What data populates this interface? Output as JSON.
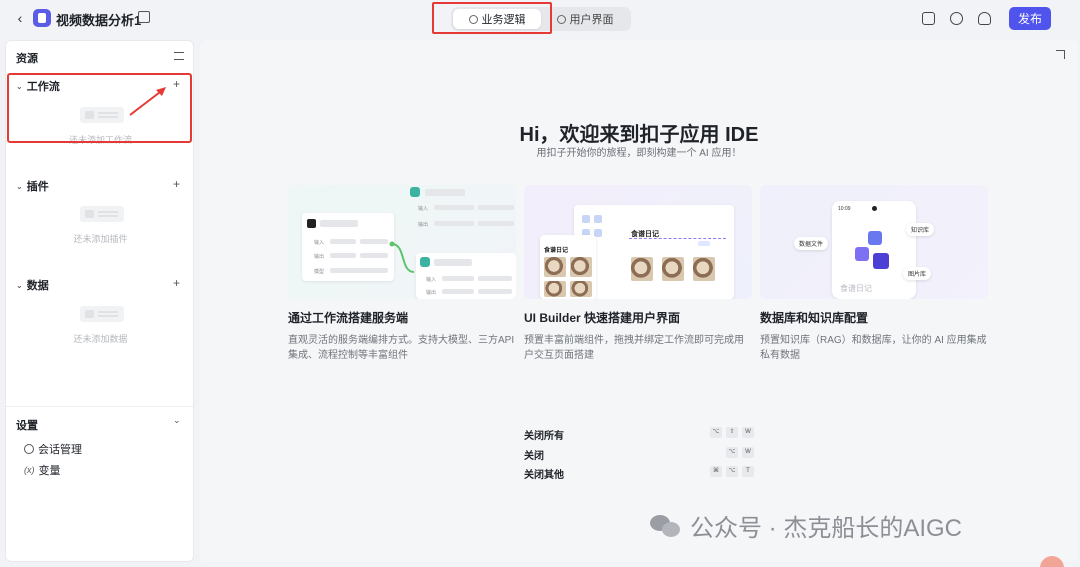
{
  "header": {
    "app_title": "视频数据分析1",
    "tabs": [
      {
        "label": "业务逻辑",
        "active": true
      },
      {
        "label": "用户界面",
        "active": false
      }
    ],
    "publish_label": "发布"
  },
  "sidebar": {
    "title": "资源",
    "sections": [
      {
        "title": "工作流",
        "empty_text": "还未添加工作流"
      },
      {
        "title": "插件",
        "empty_text": "还未添加插件"
      },
      {
        "title": "数据",
        "empty_text": "还未添加数据"
      }
    ],
    "settings": {
      "title": "设置",
      "items": [
        {
          "label": "会话管理",
          "icon": "chat-settings-icon"
        },
        {
          "label": "变量",
          "icon": "variable-icon"
        }
      ]
    }
  },
  "main": {
    "hero_title": "Hi，欢迎来到扣子应用 IDE",
    "hero_subtitle": "用扣子开始你的旅程，即刻构建一个 AI 应用！",
    "cards": [
      {
        "title": "通过工作流搭建服务端",
        "desc": "直观灵活的服务端编排方式。支持大模型、三方API集成、流程控制等丰富组件",
        "illus": {
          "in": "输入",
          "out": "输出",
          "model": "模型"
        }
      },
      {
        "title": "UI Builder 快速搭建用户界面",
        "desc": "预置丰富前端组件，拖拽并绑定工作流即可完成用户交互页面搭建",
        "illus": {
          "recipe": "食谱日记"
        }
      },
      {
        "title": "数据库和知识库配置",
        "desc": "预置知识库（RAG）和数据库，让你的 AI 应用集成私有数据",
        "illus": {
          "data_file": "数据文件",
          "knowledge": "知识库",
          "image_lib": "图片库",
          "recipe": "食谱日记",
          "time": "10:09"
        }
      }
    ],
    "shortcuts": [
      {
        "label": "关闭所有",
        "keys": [
          "⌥",
          "⇧",
          "W"
        ]
      },
      {
        "label": "关闭",
        "keys": [
          "⌥",
          "W"
        ]
      },
      {
        "label": "关闭其他",
        "keys": [
          "⌘",
          "⌥",
          "T"
        ]
      }
    ]
  },
  "watermark": "公众号 · 杰克船长的AIGC",
  "colors": {
    "accent": "#4e54ec",
    "highlight": "#e53935"
  }
}
